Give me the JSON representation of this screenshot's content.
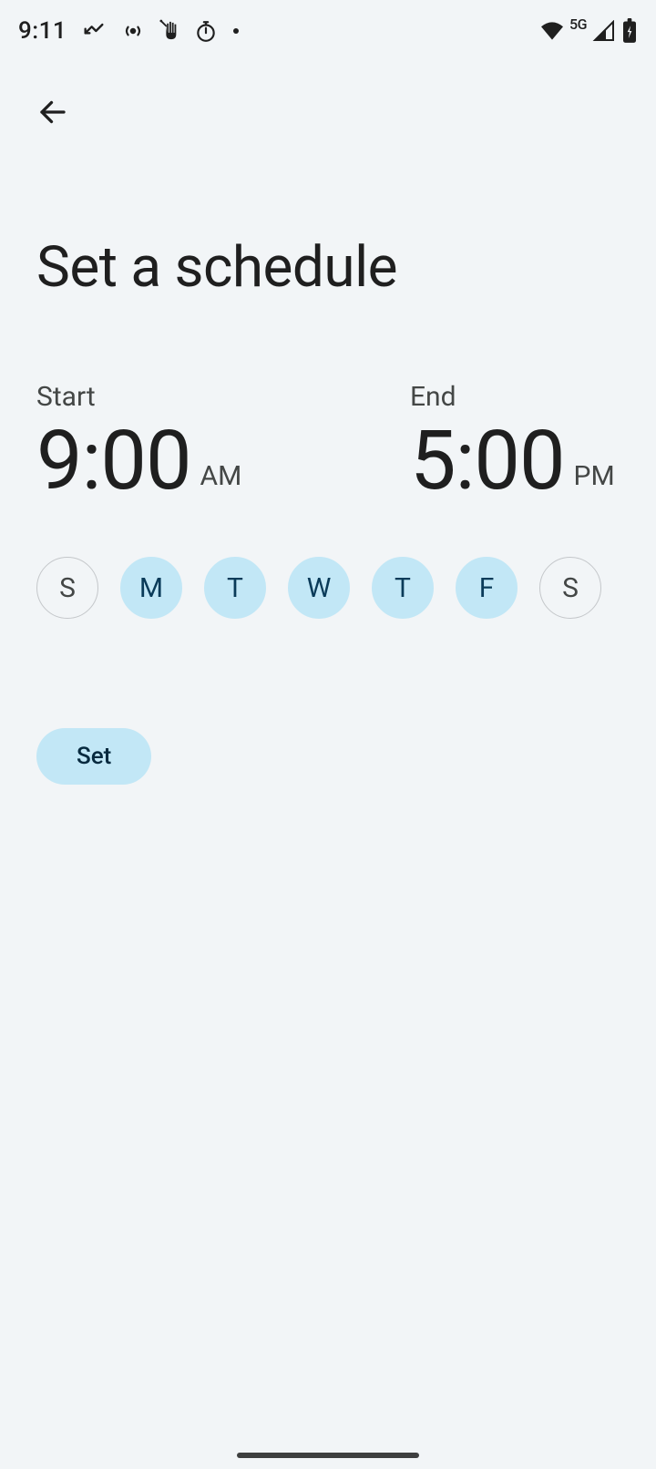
{
  "status_bar": {
    "time": "9:11",
    "network_label": "5G"
  },
  "app_bar": {
    "back_label": "back"
  },
  "page": {
    "title": "Set a schedule"
  },
  "schedule": {
    "start_label": "Start",
    "start_time": "9:00",
    "start_period": "AM",
    "end_label": "End",
    "end_time": "5:00",
    "end_period": "PM"
  },
  "days": [
    {
      "letter": "S",
      "name": "sunday",
      "selected": false
    },
    {
      "letter": "M",
      "name": "monday",
      "selected": true
    },
    {
      "letter": "T",
      "name": "tuesday",
      "selected": true
    },
    {
      "letter": "W",
      "name": "wednesday",
      "selected": true
    },
    {
      "letter": "T",
      "name": "thursday",
      "selected": true
    },
    {
      "letter": "F",
      "name": "friday",
      "selected": true
    },
    {
      "letter": "S",
      "name": "saturday",
      "selected": false
    }
  ],
  "actions": {
    "set_label": "Set"
  }
}
